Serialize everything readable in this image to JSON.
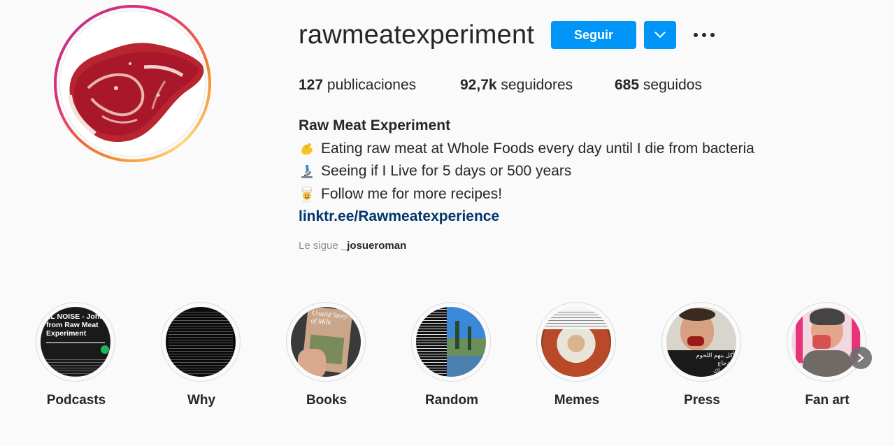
{
  "profile": {
    "username": "rawmeatexperiment",
    "follow_label": "Seguir",
    "stats": {
      "posts_count": "127",
      "posts_label": "publicaciones",
      "followers_count": "92,7k",
      "followers_label": "seguidores",
      "following_count": "685",
      "following_label": "seguidos"
    },
    "bio": {
      "full_name": "Raw Meat Experiment",
      "lines": [
        {
          "icon": "pinching-hand-emoji",
          "text": "Eating raw meat at Whole Foods every day until I die from bacteria"
        },
        {
          "icon": "microscope-emoji",
          "text": "Seeing if I Live for 5 days or 500 years"
        },
        {
          "icon": "cook-emoji",
          "text": "Follow me for more recipes!"
        }
      ],
      "link": "linktr.ee/Rawmeatexperience"
    },
    "followed_by": {
      "prefix": "Le sigue",
      "user": "_josueroman"
    }
  },
  "highlights": [
    {
      "label": "Podcasts",
      "cover_text": "LL NOISE - John from Raw Meat Experiment"
    },
    {
      "label": "Why"
    },
    {
      "label": "Books",
      "cover_text": "Untold Story of Milk"
    },
    {
      "label": "Random"
    },
    {
      "label": "Memes"
    },
    {
      "label": "Press",
      "cover_text": "يأكل بنهم اللحوم والدجاج والأسماك"
    },
    {
      "label": "Fan art"
    }
  ],
  "colors": {
    "accent": "#0095f6",
    "link": "#00376b",
    "background": "#fafafa",
    "text": "#262626",
    "muted": "#8e8e8e"
  }
}
